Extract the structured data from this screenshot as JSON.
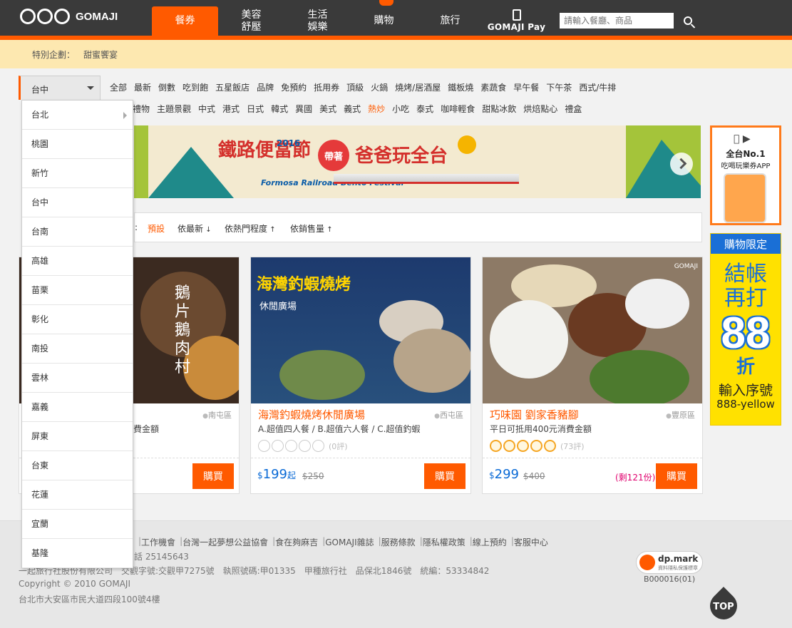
{
  "header": {
    "logo_text": "GOMAJI",
    "nav": [
      {
        "label": "餐券",
        "active": true
      },
      {
        "label": "美容\n舒壓"
      },
      {
        "label": "生活\n娛樂"
      },
      {
        "label": "購物"
      },
      {
        "label": "旅行"
      }
    ],
    "pay_label": "GOMAJI Pay",
    "search_placeholder": "請輸入餐廳、商品"
  },
  "special": {
    "label": "特別企劃：",
    "link": "甜蜜饗宴"
  },
  "city_select": {
    "value": "台中"
  },
  "categories_row1": [
    "全部",
    "最新",
    "倒數",
    "吃到飽",
    "五星飯店",
    "品牌",
    "免預約",
    "抵用券",
    "頂級",
    "火鍋",
    "燒烤/居酒屋",
    "鐵板燒",
    "素蔬食",
    "早午餐",
    "下午茶",
    "西式/牛排"
  ],
  "categories_row2": [
    "禮物",
    "主題景觀",
    "中式",
    "港式",
    "日式",
    "韓式",
    "異國",
    "美式",
    "義式",
    "熱炒",
    "小吃",
    "泰式",
    "咖啡輕食",
    "甜點冰飲",
    "烘焙點心",
    "禮盒"
  ],
  "banner": {
    "title_part1": "鐵路便當節",
    "year": "2016",
    "bubble": "帶著",
    "title_part2": "爸爸玩全台",
    "subtitle": "Formosa Railroad Bento Festival"
  },
  "sort": {
    "colon": ":",
    "items": [
      {
        "label": "預設",
        "active": true
      },
      {
        "label": "依最新"
      },
      {
        "label": "依熱門程度"
      },
      {
        "label": "依銷售量"
      }
    ]
  },
  "cards": [
    {
      "img_text": "鵝片鵝肉村",
      "name": "",
      "location": "南屯區",
      "desc": "費金額",
      "price": "",
      "orig": "",
      "buy": "購買"
    },
    {
      "img_text": "海灣釣蝦燒烤",
      "img_sub": "休閒廣場",
      "name": "海灣釣蝦燒烤休閒廣場",
      "location": "西屯區",
      "desc": "A.超值四人餐 / B.超值六人餐 / C.超值釣蝦",
      "reviews": "(0評)",
      "rating": 0,
      "price_symbol": "$",
      "price": "199",
      "price_suffix": "起",
      "orig": "$250",
      "buy": "購買"
    },
    {
      "img_text": "GOMAJI",
      "name": "巧味園 劉家香豬腳",
      "location": "豐原區",
      "desc": "平日可抵用400元消費金額",
      "reviews": "(73評)",
      "rating": 5,
      "price_symbol": "$",
      "price": "299",
      "orig": "$400",
      "remain": "(剩121份)",
      "buy": "購買"
    }
  ],
  "ad_app": {
    "line1": "全台No.1",
    "line2": "吃喝玩樂券APP"
  },
  "ad_88": {
    "top": "購物限定",
    "line1": "結帳",
    "line2": "再打",
    "big": "88",
    "zhe": "折",
    "line3": "輸入序號",
    "line4": "888-yellow"
  },
  "dropdown": [
    "台北",
    "桃園",
    "新竹",
    "台中",
    "台南",
    "高雄",
    "苗栗",
    "彰化",
    "南投",
    "雲林",
    "嘉義",
    "屏東",
    "台東",
    "花蓮",
    "宜蘭",
    "基隆"
  ],
  "footer": {
    "links": [
      "工作機會",
      "台灣一起夢想公益協會",
      "食在夠麻吉",
      "GOMAJI雜誌",
      "服務條款",
      "隱私權政策",
      "線上預約",
      "客服中心"
    ],
    "phone_tail": "話 25145643",
    "company": "一起旅行社股份有限公司　交觀字號:交觀甲7275號　執照號碼:甲01335　甲種旅行社　品保北1846號　統編：53334842",
    "copyright": "Copyright © 2010 GOMAJI",
    "address": "台北市大安區市民大道四段100號4樓",
    "dpmark": "dp.mark",
    "dpmark_sub": "資料隱私保護標章",
    "dpcode": "B000016(01)",
    "top_label": "TOP"
  }
}
